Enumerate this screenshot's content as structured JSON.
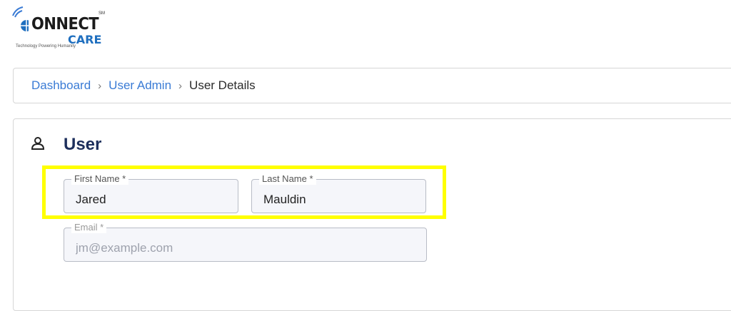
{
  "brand": {
    "name_part1": "ONNECT",
    "name_part2": "CARE",
    "trademark": "SM",
    "tagline": "Technology Powering Humanity"
  },
  "breadcrumb": {
    "items": [
      "Dashboard",
      "User Admin",
      "User Details"
    ]
  },
  "section": {
    "title": "User",
    "icon": "person-icon"
  },
  "form": {
    "first_name": {
      "label": "First Name *",
      "value": "Jared"
    },
    "last_name": {
      "label": "Last Name *",
      "value": "Mauldin"
    },
    "email": {
      "label": "Email *",
      "placeholder": "jm@example.com",
      "value": ""
    }
  },
  "colors": {
    "highlight": "#ffff00",
    "link": "#3a7bd5",
    "title": "#1d2f5c",
    "brand_blue": "#1f6fbf"
  }
}
